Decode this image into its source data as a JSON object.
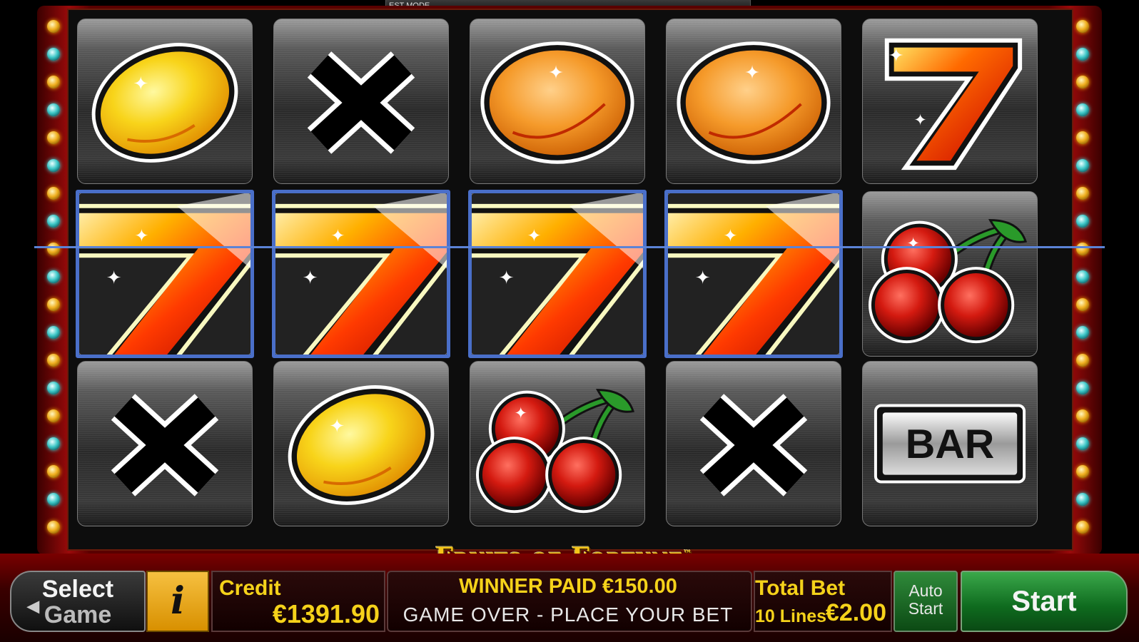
{
  "window": {
    "mode_label": "EST MODE"
  },
  "logo": {
    "text": "Fruits of Fortune",
    "trademark": "™"
  },
  "reels": {
    "rows": [
      [
        "lemon",
        "x",
        "orange",
        "orange",
        "seven"
      ],
      [
        "seven",
        "seven",
        "seven",
        "seven",
        "cherry"
      ],
      [
        "x",
        "lemon",
        "cherry",
        "x",
        "bar"
      ]
    ],
    "winning_row": 2,
    "winning_positions": [
      1,
      2,
      3,
      4
    ],
    "bar_label": "BAR"
  },
  "controls": {
    "select_game_line1": "Select",
    "select_game_line2": "Game",
    "info_label": "i",
    "credit_label": "Credit",
    "credit_value": "€1391.90",
    "message_top": "WINNER PAID €150.00",
    "message_bottom": "GAME OVER -  PLACE YOUR BET",
    "total_bet_label": "Total Bet",
    "lines_label": "10 Lines",
    "total_bet_value": "€2.00",
    "auto_start_line1": "Auto",
    "auto_start_line2": "Start",
    "start_label": "Start"
  },
  "colors": {
    "accent_yellow": "#f5d21a",
    "payline_blue": "#5b83d6",
    "frame_red": "#5a0000",
    "start_green": "#0e6a1e"
  }
}
